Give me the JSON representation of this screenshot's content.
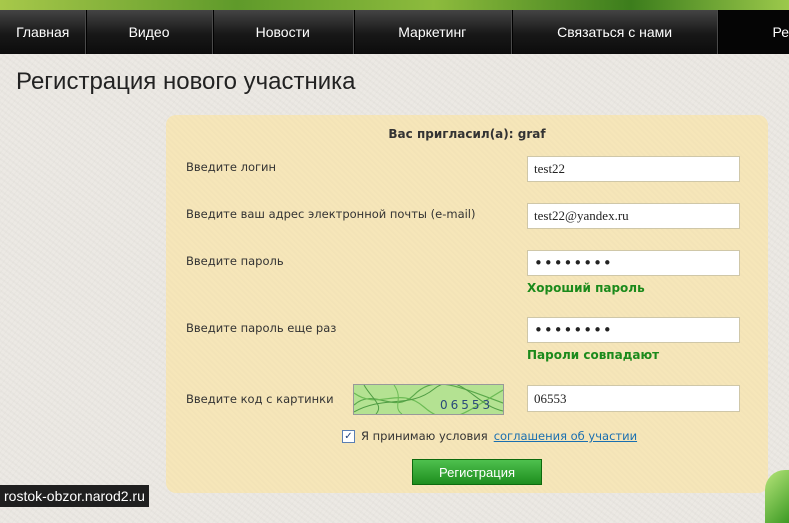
{
  "nav": {
    "items": [
      "Главная",
      "Видео",
      "Новости",
      "Маркетинг",
      "Связаться с нами",
      "Ре"
    ]
  },
  "page_title": "Регистрация нового участника",
  "form": {
    "invited_by": "Вас пригласил(а): graf",
    "login_label": "Введите логин",
    "login_value": "test22",
    "email_label": "Введите ваш адрес электронной почты (e-mail)",
    "email_value": "test22@yandex.ru",
    "password_label": "Введите пароль",
    "password_value": "••••••••",
    "password_hint": "Хороший пароль",
    "password_repeat_label": "Введите пароль еще раз",
    "password_repeat_value": "••••••••",
    "password_repeat_hint": "Пароли совпадают",
    "captcha_label": "Введите код с картинки",
    "captcha_text": "06553",
    "captcha_value": "06553",
    "terms_text": "Я принимаю условия",
    "terms_link": "соглашения об участии",
    "terms_checked": true,
    "submit_label": "Регистрация"
  },
  "watermark": "rostok-obzor.narod2.ru",
  "colors": {
    "panel": "#f6e6b9",
    "hint_green": "#1b8a1b",
    "link_blue": "#1a6fb0",
    "button_green": "#2ea32e"
  }
}
